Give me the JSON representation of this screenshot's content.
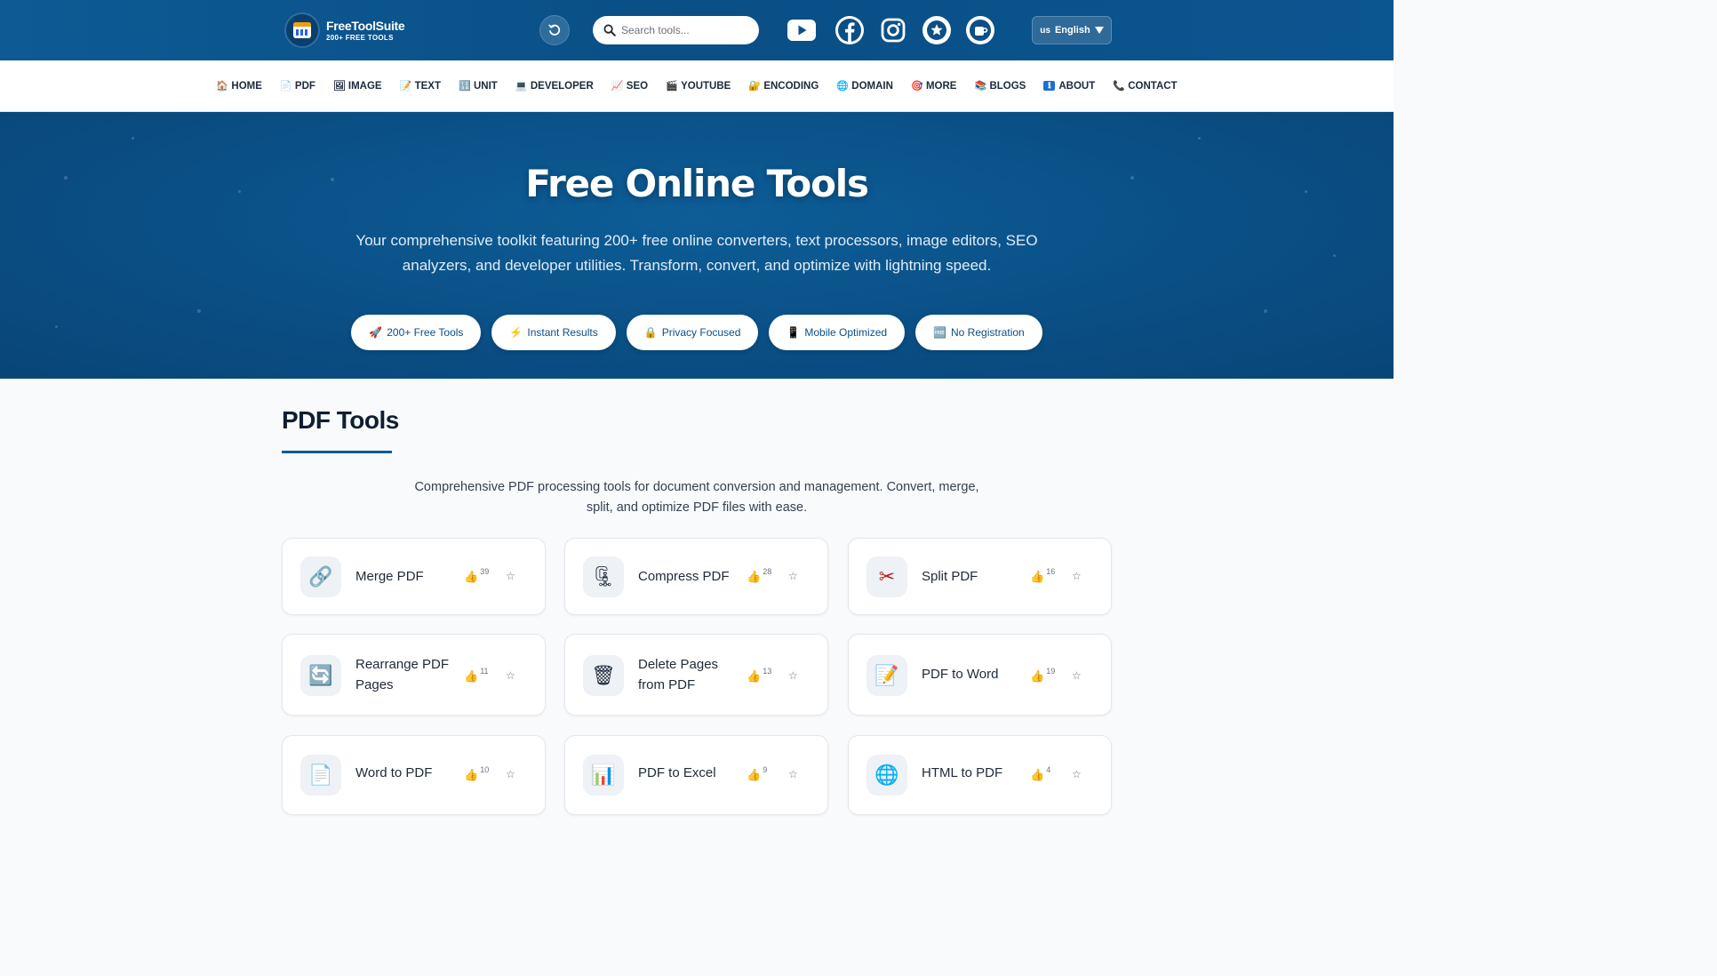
{
  "brand": {
    "title": "FreeToolSuite",
    "subtitle": "200+ FREE TOOLS"
  },
  "search": {
    "placeholder": "Search tools..."
  },
  "social": [
    "youtube-icon",
    "facebook-icon",
    "instagram-icon",
    "star-icon",
    "coffee-icon"
  ],
  "language": {
    "flag": "us",
    "label": "English"
  },
  "nav": [
    {
      "icon": "🏠",
      "label": "HOME"
    },
    {
      "icon": "📄",
      "label": "PDF"
    },
    {
      "icon": "🖼",
      "label": "IMAGE"
    },
    {
      "icon": "📝",
      "label": "TEXT"
    },
    {
      "icon": "🔢",
      "label": "UNIT"
    },
    {
      "icon": "💻",
      "label": "DEVELOPER"
    },
    {
      "icon": "📈",
      "label": "SEO"
    },
    {
      "icon": "🎬",
      "label": "YOUTUBE"
    },
    {
      "icon": "🔐",
      "label": "ENCODING"
    },
    {
      "icon": "🌐",
      "label": "DOMAIN"
    },
    {
      "icon": "🎯",
      "label": "MORE"
    },
    {
      "icon": "📚",
      "label": "BLOGS"
    },
    {
      "icon": "ℹ",
      "label": "ABOUT"
    },
    {
      "icon": "📞",
      "label": "CONTACT"
    }
  ],
  "hero": {
    "title": "Free Online Tools",
    "description": "Your comprehensive toolkit featuring 200+ free online converters, text processors, image editors, SEO analyzers, and developer utilities. Transform, convert, and optimize with lightning speed.",
    "features": [
      {
        "icon": "🚀",
        "label": "200+ Free Tools"
      },
      {
        "icon": "⚡",
        "label": "Instant Results"
      },
      {
        "icon": "🔒",
        "label": "Privacy Focused"
      },
      {
        "icon": "📱",
        "label": "Mobile Optimized"
      },
      {
        "icon": "🆓",
        "label": "No Registration"
      }
    ]
  },
  "section": {
    "title": "PDF Tools",
    "description": "Comprehensive PDF processing tools for document conversion and management. Convert, merge, split, and optimize PDF files with ease.",
    "tools": [
      {
        "icon": "🔗",
        "name": "Merge PDF",
        "likes": "39"
      },
      {
        "icon": "🗜",
        "name": "Compress PDF",
        "likes": "28"
      },
      {
        "icon": "✂",
        "name": "Split PDF",
        "likes": "16"
      },
      {
        "icon": "🔄",
        "name": "Rearrange PDF Pages",
        "likes": "11"
      },
      {
        "icon": "🗑",
        "name": "Delete Pages from PDF",
        "likes": "13"
      },
      {
        "icon": "📝",
        "name": "PDF to Word",
        "likes": "19"
      },
      {
        "icon": "📄",
        "name": "Word to PDF",
        "likes": "10"
      },
      {
        "icon": "📊",
        "name": "PDF to Excel",
        "likes": "9"
      },
      {
        "icon": "🌐",
        "name": "HTML to PDF",
        "likes": "4"
      }
    ]
  },
  "colors": {
    "header": "#0b5590",
    "accent": "#0b5a96",
    "like": "#f5b301"
  }
}
